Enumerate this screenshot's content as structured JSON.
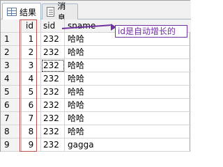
{
  "tabs": [
    {
      "label": "结果",
      "icon": "grid-icon",
      "active": true
    },
    {
      "label": "消息",
      "icon": "messages-icon",
      "active": false
    }
  ],
  "columns": [
    "id",
    "sid",
    "sname"
  ],
  "rows": [
    {
      "num": "1",
      "id": "1",
      "sid": "232",
      "sname": "哈哈"
    },
    {
      "num": "2",
      "id": "2",
      "sid": "232",
      "sname": "哈哈"
    },
    {
      "num": "3",
      "id": "3",
      "sid": "232",
      "sname": "哈哈"
    },
    {
      "num": "4",
      "id": "4",
      "sid": "232",
      "sname": "哈哈"
    },
    {
      "num": "5",
      "id": "5",
      "sid": "232",
      "sname": "哈哈"
    },
    {
      "num": "6",
      "id": "6",
      "sid": "232",
      "sname": "哈哈"
    },
    {
      "num": "7",
      "id": "7",
      "sid": "232",
      "sname": "哈哈"
    },
    {
      "num": "8",
      "id": "8",
      "sid": "232",
      "sname": "哈哈"
    },
    {
      "num": "9",
      "id": "9",
      "sid": "232",
      "sname": "gagga"
    }
  ],
  "annotation": "id是自动增长的",
  "colors": {
    "annotation": "#7030a0",
    "highlight": "#c0504d"
  }
}
